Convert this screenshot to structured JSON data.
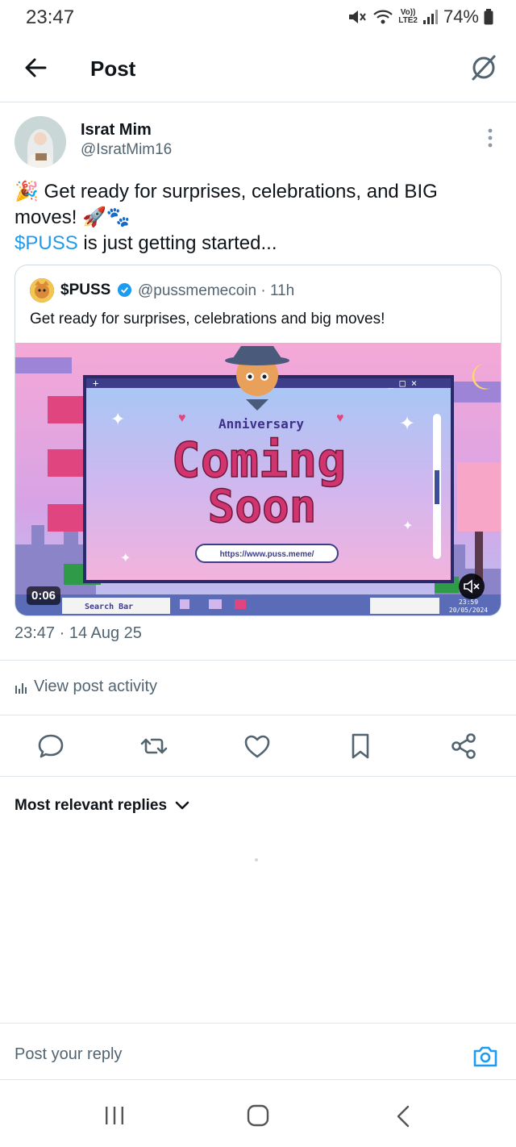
{
  "status_bar": {
    "time": "23:47",
    "network_top": "Vo))",
    "network_bottom": "LTE2",
    "battery": "74%"
  },
  "header": {
    "title": "Post",
    "back_icon": "arrow-left-icon",
    "grok_icon": "grok-icon"
  },
  "post": {
    "author_name": "Israt Mim",
    "author_handle": "@IsratMim16",
    "text_line1": "🎉 Get ready for surprises, celebrations, and BIG",
    "text_line2": "moves! 🚀🐾",
    "cashtag": "$PUSS",
    "text_line3_rest": " is just getting started...",
    "timestamp": "23:47 · 14 Aug 25",
    "view_activity": "View post activity"
  },
  "quoted": {
    "name": "$PUSS",
    "handle_time": "@pussmemecoin · 11h",
    "text": "Get ready for surprises, celebrations and big moves!",
    "media": {
      "duration": "0:06",
      "window_title": "Anniversary",
      "headline1": "Coming",
      "headline2": "Soon",
      "url": "https://www.puss.meme/",
      "search_bar": "Search Bar",
      "clock_time": "23:59",
      "clock_date": "20/05/2024"
    }
  },
  "actions": [
    "reply-icon",
    "repost-icon",
    "like-icon",
    "bookmark-icon",
    "share-icon"
  ],
  "replies": {
    "sort_label": "Most relevant replies"
  },
  "reply_bar": {
    "placeholder": "Post your reply"
  },
  "colors": {
    "accent": "#1d9bf0",
    "text": "#0f1419",
    "muted": "#536471",
    "border": "#cfd9de"
  }
}
